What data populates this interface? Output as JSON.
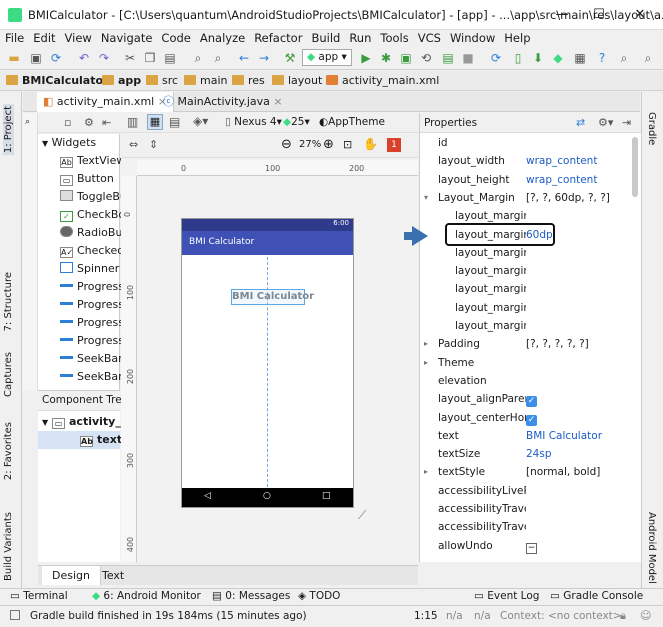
{
  "window": {
    "title": "BMICalculator - [C:\\Users\\quantum\\AndroidStudioProjects\\BMICalculator] - [app] - ...\\app\\src\\main\\res\\layout\\a...",
    "minimize": "—",
    "maximize": "☐",
    "close": "✕"
  },
  "menu": [
    "File",
    "Edit",
    "View",
    "Navigate",
    "Code",
    "Analyze",
    "Refactor",
    "Build",
    "Run",
    "Tools",
    "VCS",
    "Window",
    "Help"
  ],
  "toolbar": {
    "run_config": "app"
  },
  "breadcrumb": [
    "BMICalculator",
    "app",
    "src",
    "main",
    "res",
    "layout",
    "activity_main.xml"
  ],
  "editor_tabs": [
    "activity_main.xml",
    "MainActivity.java"
  ],
  "left_strip": [
    "1: Project",
    "7: Structure",
    "Captures",
    "2: Favorites",
    "Build Variants"
  ],
  "right_strip": [
    "Gradle",
    "Android Model"
  ],
  "palette": {
    "header": "Widgets",
    "items": [
      "TextView",
      "Button",
      "ToggleBu",
      "CheckBox",
      "RadioButt",
      "CheckedT",
      "Spinner",
      "ProgressB",
      "ProgressB",
      "ProgressB",
      "ProgressB",
      "SeekBar",
      "SeekBar (I"
    ]
  },
  "component_tree": {
    "header": "Component Tree",
    "items": [
      "activity_m",
      "textV"
    ]
  },
  "design": {
    "device": "Nexus 4",
    "api": "25",
    "theme": "AppTheme",
    "zoom": "27%",
    "error_count": "1",
    "ruler_h": [
      "0",
      "100",
      "200"
    ],
    "ruler_v": [
      "0",
      "100",
      "200",
      "300",
      "400"
    ],
    "phone_time": "6:00",
    "app_title": "BMI Calculator",
    "textview_text": "BMI Calculator"
  },
  "properties": {
    "header": "Properties",
    "rows": [
      {
        "name": "id",
        "value": "",
        "blue": false,
        "indent": 0
      },
      {
        "name": "layout_width",
        "value": "wrap_content",
        "blue": true,
        "indent": 0
      },
      {
        "name": "layout_height",
        "value": "wrap_content",
        "blue": true,
        "indent": 0
      },
      {
        "name": "Layout_Margin",
        "value": "[?, ?, 60dp, ?, ?]",
        "blue": false,
        "indent": 0,
        "expand": "▾"
      },
      {
        "name": "layout_margin",
        "value": "",
        "blue": false,
        "indent": 1
      },
      {
        "name": "layout_marginT",
        "value": "60dp",
        "blue": true,
        "indent": 1,
        "highlight": true
      },
      {
        "name": "layout_marginB",
        "value": "",
        "blue": false,
        "indent": 1
      },
      {
        "name": "layout_marginE",
        "value": "",
        "blue": false,
        "indent": 1
      },
      {
        "name": "layout_marginL",
        "value": "",
        "blue": false,
        "indent": 1
      },
      {
        "name": "layout_marginR",
        "value": "",
        "blue": false,
        "indent": 1
      },
      {
        "name": "layout_marginS",
        "value": "",
        "blue": false,
        "indent": 1
      },
      {
        "name": "Padding",
        "value": "[?, ?, ?, ?, ?]",
        "blue": false,
        "indent": 0,
        "expand": "▸"
      },
      {
        "name": "Theme",
        "value": "",
        "blue": false,
        "indent": 0,
        "expand": "▸"
      },
      {
        "name": "elevation",
        "value": "",
        "blue": false,
        "indent": 0
      },
      {
        "name": "layout_alignParentT",
        "value": "check",
        "blue": false,
        "indent": 0
      },
      {
        "name": "layout_centerHorizo",
        "value": "check",
        "blue": false,
        "indent": 0
      },
      {
        "name": "text",
        "value": "BMI Calculator",
        "blue": true,
        "indent": 0
      },
      {
        "name": "textSize",
        "value": "24sp",
        "blue": true,
        "indent": 0
      },
      {
        "name": "textStyle",
        "value": "[normal, bold]",
        "blue": false,
        "indent": 0,
        "expand": "▸"
      },
      {
        "name": "accessibilityLiveReg",
        "value": "",
        "blue": false,
        "indent": 0
      },
      {
        "name": "accessibilityTravers",
        "value": "",
        "blue": false,
        "indent": 0
      },
      {
        "name": "accessibilityTraversa",
        "value": "",
        "blue": false,
        "indent": 0
      },
      {
        "name": "allowUndo",
        "value": "minus",
        "blue": false,
        "indent": 0
      }
    ]
  },
  "bottom_tabs": [
    "Design",
    "Text"
  ],
  "tool_tabs": [
    "Terminal",
    "6: Android Monitor",
    "0: Messages",
    "TODO",
    "Event Log",
    "Gradle Console"
  ],
  "status": {
    "message": "Gradle build finished in 19s 184ms (15 minutes ago)",
    "position": "1:15",
    "na1": "n/a",
    "na2": "n/a",
    "context": "Context: <no context>"
  }
}
